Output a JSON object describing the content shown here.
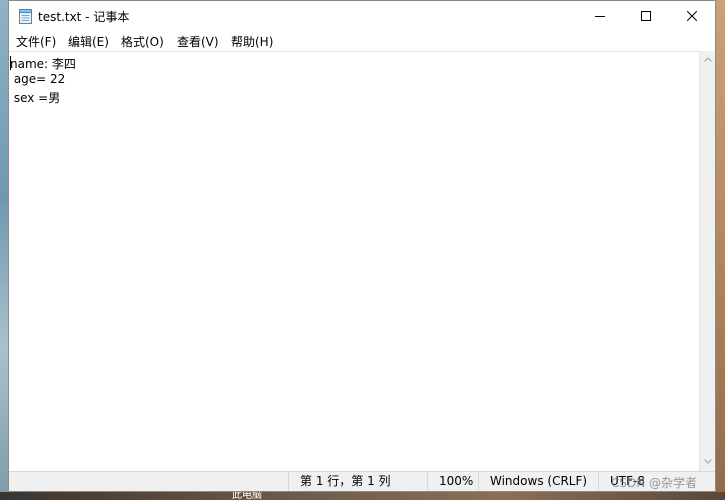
{
  "window": {
    "title": "test.txt - 记事本",
    "icon": "notepad-icon"
  },
  "controls": {
    "minimize_icon": "minimize-icon",
    "maximize_icon": "maximize-icon",
    "close_icon": "close-icon"
  },
  "menu": [
    {
      "label": "文件(F)"
    },
    {
      "label": "编辑(E)"
    },
    {
      "label": "格式(O)"
    },
    {
      "label": "查看(V)"
    },
    {
      "label": "帮助(H)"
    }
  ],
  "editor": {
    "lines": [
      "name: 李四",
      " age= 22",
      " sex =男"
    ]
  },
  "statusbar": {
    "position": "第 1 行，第 1 列",
    "zoom": "100%",
    "line_ending": "Windows (CRLF)",
    "encoding": "UTF-8"
  },
  "watermark": "CSDN @杂学者",
  "desktop_text": "此电脑"
}
